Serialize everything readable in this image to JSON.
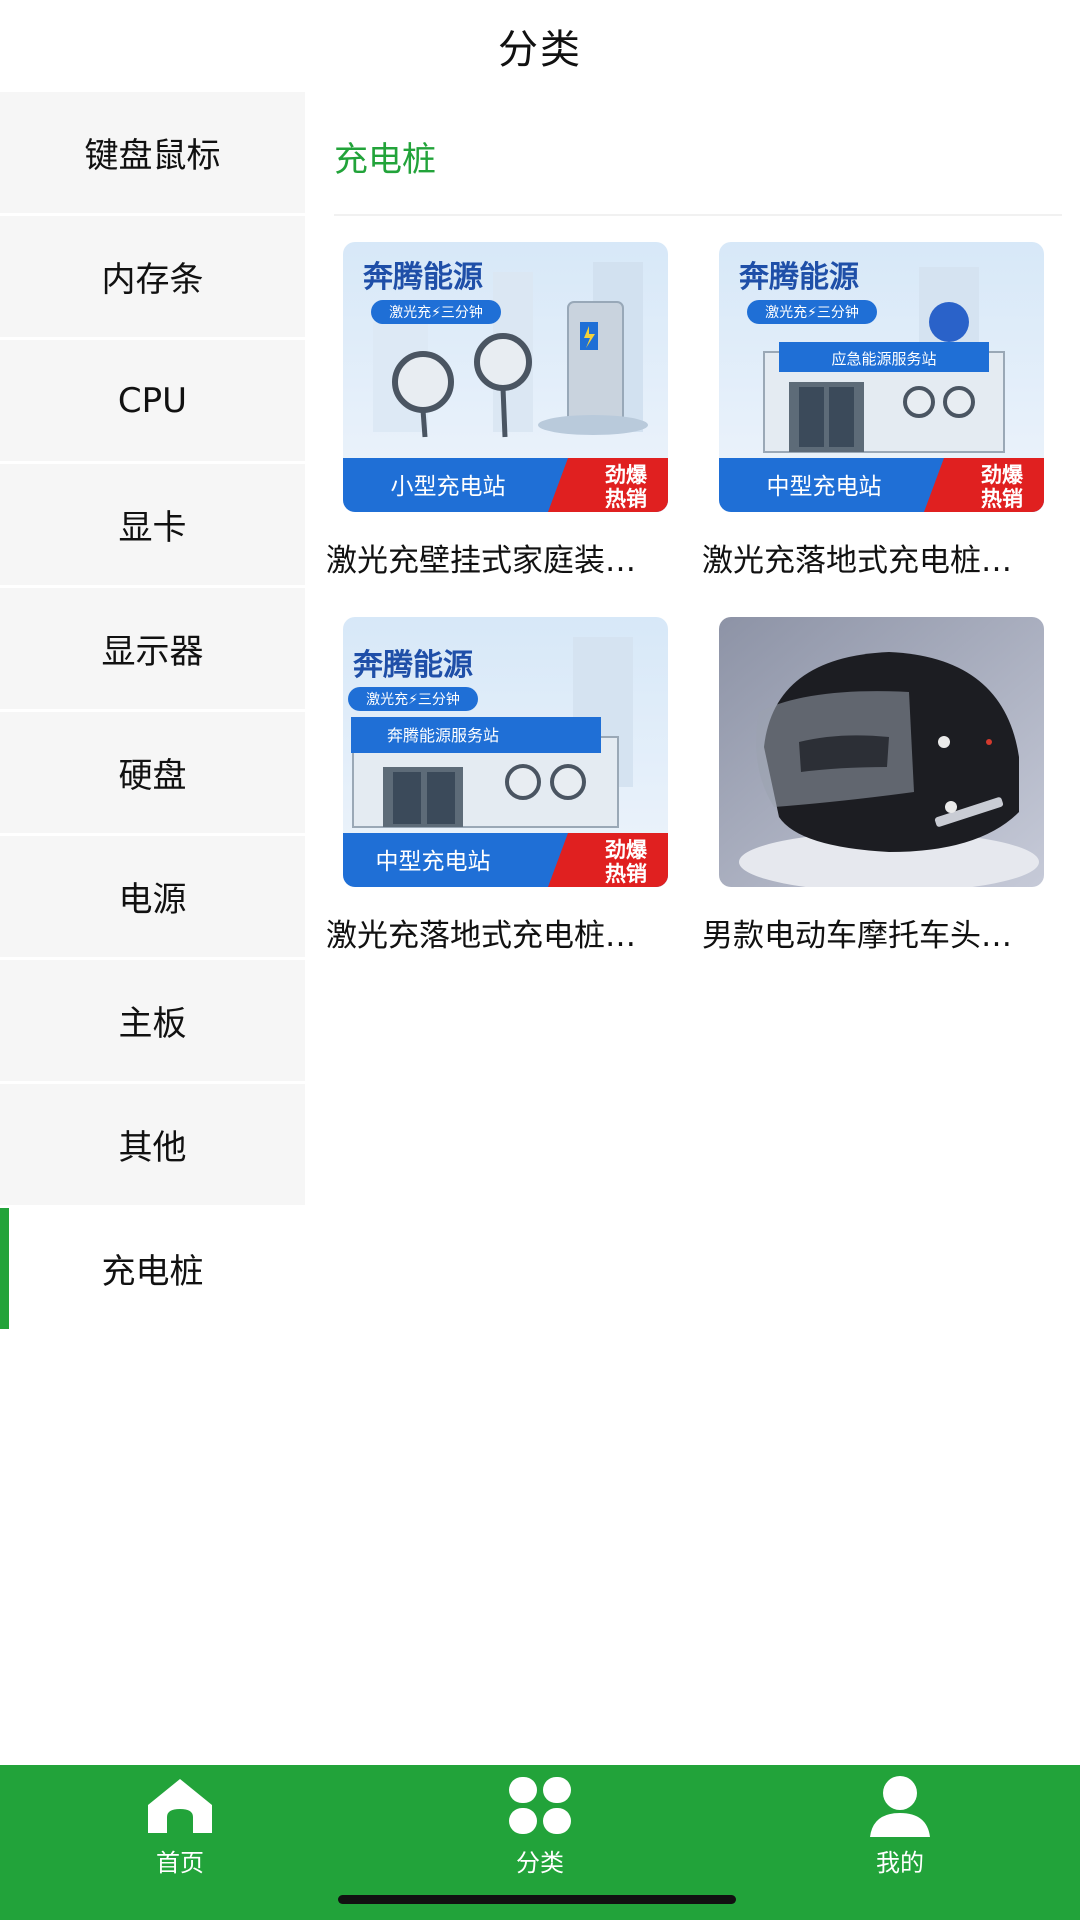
{
  "header": {
    "title": "分类"
  },
  "sidebar": {
    "items": [
      {
        "label": "键盘鼠标"
      },
      {
        "label": "内存条"
      },
      {
        "label": "CPU"
      },
      {
        "label": "显卡"
      },
      {
        "label": "显示器"
      },
      {
        "label": "硬盘"
      },
      {
        "label": "电源"
      },
      {
        "label": "主板"
      },
      {
        "label": "其他"
      },
      {
        "label": "充电桩",
        "active": true
      }
    ]
  },
  "content": {
    "section_title": "充电桩",
    "products": [
      {
        "name": "激光充壁挂式家庭装…",
        "image_brand": "奔腾能源",
        "image_tagline": "激光充⚡三分钟",
        "image_caption": "小型充电站",
        "image_badge_1": "劲爆",
        "image_badge_2": "热销"
      },
      {
        "name": "激光充落地式充电桩…",
        "image_brand": "奔腾能源",
        "image_tagline": "激光充⚡三分钟",
        "image_sign": "应急能源服务站",
        "image_caption": "中型充电站",
        "image_badge_1": "劲爆",
        "image_badge_2": "热销"
      },
      {
        "name": "激光充落地式充电桩…",
        "image_brand": "奔腾能源",
        "image_tagline": "激光充⚡三分钟",
        "image_sign": "奔腾能源服务站",
        "image_caption": "中型充电站",
        "image_badge_1": "劲爆",
        "image_badge_2": "热销"
      },
      {
        "name": "男款电动车摩托车头…"
      }
    ]
  },
  "bottom_nav": {
    "items": [
      {
        "label": "首页",
        "icon": "home-icon"
      },
      {
        "label": "分类",
        "icon": "grid-icon"
      },
      {
        "label": "我的",
        "icon": "user-icon"
      }
    ]
  },
  "colors": {
    "accent": "#22a33a",
    "sidebar_bg": "#f6f6f6",
    "card_blue": "#1f6fd6",
    "badge_red": "#e02020"
  }
}
